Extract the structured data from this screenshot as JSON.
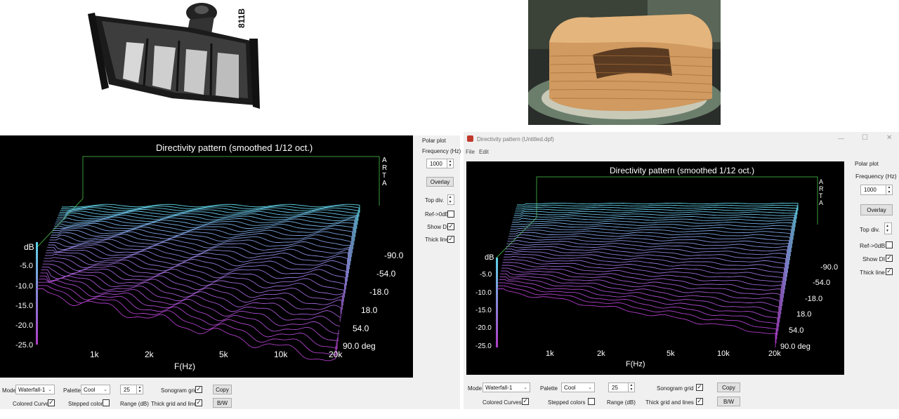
{
  "photos": {
    "left_label": "811B"
  },
  "window_left": {
    "plot": {
      "title": "Directivity pattern (smoothed 1/12 oct.)",
      "brand_letters": [
        "A",
        "R",
        "T",
        "A"
      ],
      "ylabel": "dB",
      "y_ticks": [
        "-5.0",
        "-10.0",
        "-15.0",
        "-20.0",
        "-25.0"
      ],
      "x_ticks": [
        "1k",
        "2k",
        "5k",
        "10k",
        "20k"
      ],
      "xlabel": "F(Hz)",
      "angle_ticks": [
        "-90.0",
        "-54.0",
        "-18.0",
        "18.0",
        "54.0",
        "90.0 deg"
      ]
    },
    "side": {
      "group_label": "Polar plot",
      "freq_label": "Frequency (Hz)",
      "freq_value": "1000",
      "overlay_label": "Overlay",
      "topdiv_label": "Top div.",
      "ref_label": "Ref->0dB",
      "showdi_label": "Show DI",
      "thick_label": "Thick line",
      "ref_checked": "",
      "showdi_checked": "✓",
      "thick_checked": "✓"
    },
    "bottom": {
      "mode_label": "Mode",
      "mode_value": "Waterfall-1",
      "palette_label": "Palette",
      "palette_value": "Cool",
      "range_value": "25",
      "range_label": "Range (dB)",
      "sonogram_label": "Sonogram grid",
      "sonogram_checked": "✓",
      "thickgrid_label": "Thick grid and  lines",
      "thickgrid_checked": "✓",
      "colored_label": "Colored Curves",
      "colored_checked": "✓",
      "stepped_label": "Stepped colors",
      "stepped_checked": "",
      "copy_label": "Copy",
      "bw_label": "B/W"
    }
  },
  "window_right": {
    "titlebar": {
      "title": "Directivity pattern (Untitled.dpf)",
      "minimize": "—",
      "maximize": "☐",
      "close": "✕"
    },
    "menu": [
      "File",
      "Edit"
    ],
    "plot": {
      "title": "Directivity pattern (smoothed 1/12 oct.)",
      "brand_letters": [
        "A",
        "R",
        "T",
        "A"
      ],
      "ylabel": "dB",
      "y_ticks": [
        "-5.0",
        "-10.0",
        "-15.0",
        "-20.0",
        "-25.0"
      ],
      "x_ticks": [
        "1k",
        "2k",
        "5k",
        "10k",
        "20k"
      ],
      "xlabel": "F(Hz)",
      "angle_ticks": [
        "-90.0",
        "-54.0",
        "-18.0",
        "18.0",
        "54.0",
        "90.0 deg"
      ]
    },
    "side": {
      "group_label": "Polar plot",
      "freq_label": "Frequency (Hz)",
      "freq_value": "1000",
      "overlay_label": "Overlay",
      "topdiv_label": "Top div.",
      "ref_label": "Ref->0dB",
      "showdi_label": "Show DI",
      "thick_label": "Thick line",
      "ref_checked": "",
      "showdi_checked": "✓",
      "thick_checked": "✓"
    },
    "bottom": {
      "mode_label": "Mode",
      "mode_value": "Waterfall-1",
      "palette_label": "Palette",
      "palette_value": "Cool",
      "range_value": "25",
      "range_label": "Range (dB)",
      "sonogram_label": "Sonogram grid",
      "sonogram_checked": "✓",
      "thickgrid_label": "Thick grid and  lines",
      "thickgrid_checked": "✓",
      "colored_label": "Colored Curves",
      "colored_checked": "✓",
      "stepped_label": "Stepped colors",
      "stepped_checked": "",
      "copy_label": "Copy",
      "bw_label": "B/W"
    }
  },
  "colors": {
    "plot_bg": "#000000",
    "frame": "#3a9a3a",
    "curve_top": "#5fd4e8",
    "curve_bottom": "#b03cc8",
    "axis_text": "#ffffff",
    "window_bg": "#f0f0f0",
    "title_icon": "#c0392b"
  }
}
